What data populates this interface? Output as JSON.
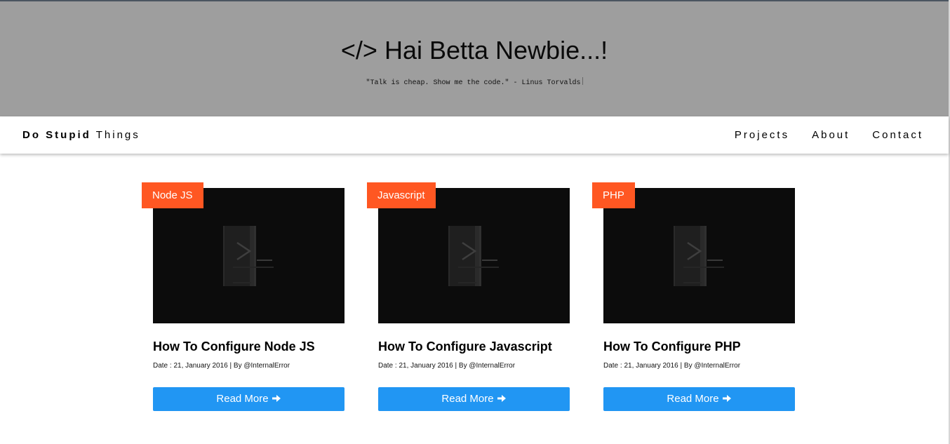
{
  "hero": {
    "title_icon": "</>",
    "title": "Hai Betta Newbie...!",
    "quote": "\"Talk is cheap. Show me the code.\" - Linus Torvalds"
  },
  "navbar": {
    "brand_bold": "Do Stupid",
    "brand_rest": "Things",
    "links": [
      "Projects",
      "About",
      "Contact"
    ]
  },
  "colors": {
    "hero_bg": "#9e9e9e",
    "tag_bg": "#ff5722",
    "button_bg": "#2196f3",
    "thumb_bg": "#0c0c0c"
  },
  "cards": [
    {
      "tag": "Node JS",
      "title": "How To Configure Node JS",
      "meta": "Date : 21, January 2016 | By @InternalError",
      "button": "Read More",
      "button_icon": "arrow-right-icon"
    },
    {
      "tag": "Javascript",
      "title": "How To Configure Javascript",
      "meta": "Date : 21, January 2016 | By @InternalError",
      "button": "Read More",
      "button_icon": "arrow-right-icon"
    },
    {
      "tag": "PHP",
      "title": "How To Configure PHP",
      "meta": "Date : 21, January 2016 | By @InternalError",
      "button": "Read More",
      "button_icon": "arrow-right-icon"
    }
  ]
}
